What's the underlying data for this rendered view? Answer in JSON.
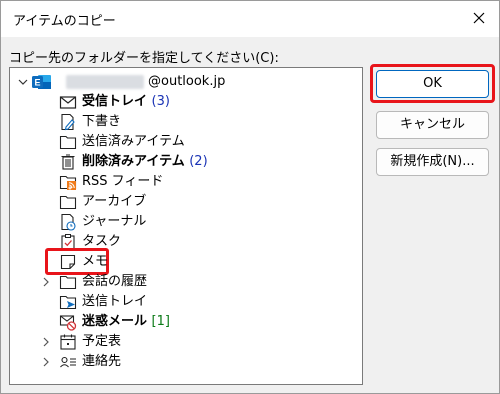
{
  "window": {
    "title": "アイテムのコピー",
    "close_icon": "close-icon"
  },
  "prompt": "コピー先のフォルダーを指定してください(C):",
  "tree": {
    "root": {
      "label_suffix": "@outlook.jp",
      "icon": "outlook-account-icon"
    },
    "items": [
      {
        "label": "受信トレイ",
        "count": "(3)",
        "bold": true,
        "icon": "inbox-icon"
      },
      {
        "label": "下書き",
        "icon": "drafts-icon"
      },
      {
        "label": "送信済みアイテム",
        "icon": "folder-icon"
      },
      {
        "label": "削除済みアイテム",
        "count": "(2)",
        "bold": true,
        "icon": "trash-icon"
      },
      {
        "label": "RSS フィード",
        "icon": "rss-icon"
      },
      {
        "label": "アーカイブ",
        "icon": "folder-icon"
      },
      {
        "label": "ジャーナル",
        "icon": "journal-icon"
      },
      {
        "label": "タスク",
        "icon": "tasks-icon"
      },
      {
        "label": "メモ",
        "icon": "notes-icon",
        "selected": true
      },
      {
        "label": "会話の履歴",
        "icon": "folder-icon",
        "expandable": true
      },
      {
        "label": "送信トレイ",
        "icon": "outbox-icon"
      },
      {
        "label": "迷惑メール",
        "count": "[1]",
        "bold": true,
        "icon": "junk-mail-icon"
      },
      {
        "label": "予定表",
        "icon": "calendar-icon",
        "expandable": true
      },
      {
        "label": "連絡先",
        "icon": "contacts-icon",
        "expandable": true
      }
    ]
  },
  "buttons": {
    "ok": "OK",
    "cancel": "キャンセル",
    "new": "新規作成(N)..."
  },
  "colors": {
    "highlight_red": "#e8141a",
    "count_blue": "#1a33b5",
    "count_green": "#0b7a17",
    "outlook_blue": "#0f6cbd"
  }
}
